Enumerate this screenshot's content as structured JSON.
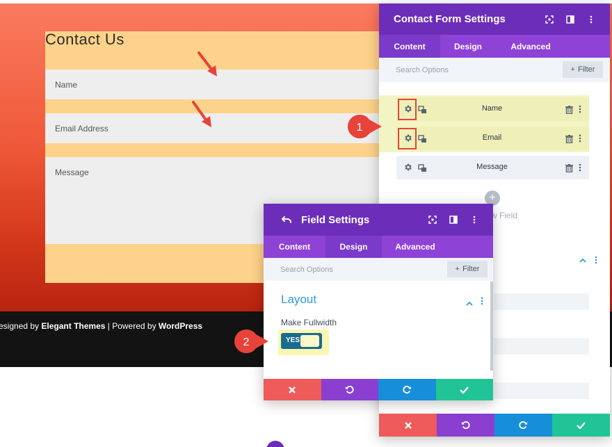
{
  "contact_form": {
    "title": "Contact Us",
    "fields": {
      "name_placeholder": "Name",
      "email_placeholder": "Email Address",
      "message_placeholder": "Message"
    }
  },
  "footer": {
    "designed_prefix": "esigned by ",
    "designed_brand": "Elegant Themes",
    "separator": " | Powered by ",
    "powered_brand": "WordPress"
  },
  "contact_form_settings": {
    "title": "Contact Form Settings",
    "tabs": [
      "Content",
      "Design",
      "Advanced"
    ],
    "active_tab": "Content",
    "search_placeholder": "Search Options",
    "filter_label": "Filter",
    "items": [
      {
        "label": "Name",
        "highlighted": true
      },
      {
        "label": "Email",
        "highlighted": true
      },
      {
        "label": "Message",
        "highlighted": false
      }
    ],
    "add_field_label": "w Field"
  },
  "field_settings": {
    "title": "Field Settings",
    "tabs": [
      "Content",
      "Design",
      "Advanced"
    ],
    "active_tab": "Design",
    "search_placeholder": "Search Options",
    "filter_label": "Filter",
    "section_title": "Layout",
    "make_fullwidth_label": "Make Fullwidth",
    "toggle_value": "YES"
  },
  "badges": {
    "one": "1",
    "two": "2"
  },
  "colors": {
    "panel_header": "#6c2eb9",
    "tab_bar": "#8e42d6",
    "accent_blue": "#2e9bd3",
    "highlight_red": "#e8433a",
    "action_red": "#ef5a5a",
    "action_purple": "#8a3fd1",
    "action_blue": "#168ed8",
    "action_green": "#21c497"
  }
}
